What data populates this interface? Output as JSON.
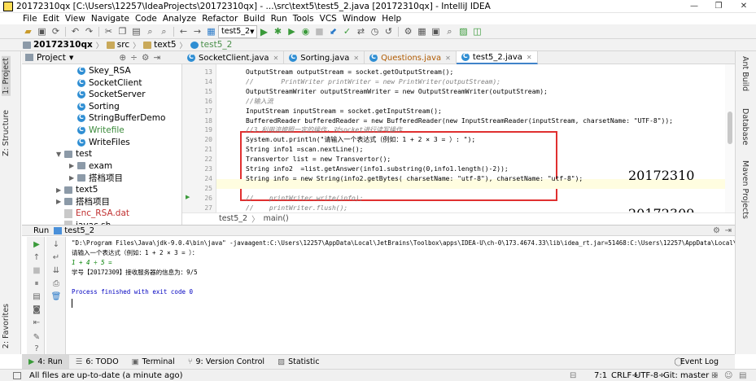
{
  "window": {
    "title": "20172310qx [C:\\Users\\12257\\IdeaProjects\\20172310qx] - ...\\src\\text5\\test5_2.java [20172310qx] - IntelliJ IDEA",
    "minimize": "—",
    "maximize": "❐",
    "close": "✕"
  },
  "menu": [
    "File",
    "Edit",
    "View",
    "Navigate",
    "Code",
    "Analyze",
    "Refactor",
    "Build",
    "Run",
    "Tools",
    "VCS",
    "Window",
    "Help"
  ],
  "toolbar": {
    "run_config": "test5_2"
  },
  "breadcrumb": [
    "20172310qx",
    "src",
    "text5",
    "test5_2"
  ],
  "project_panel": {
    "header": "Project",
    "items": [
      {
        "label": "Skey_RSA",
        "type": "class",
        "indent": 2,
        "arrow": ""
      },
      {
        "label": "SocketClient",
        "type": "class",
        "indent": 2,
        "arrow": ""
      },
      {
        "label": "SocketServer",
        "type": "class",
        "indent": 2,
        "arrow": ""
      },
      {
        "label": "Sorting",
        "type": "class",
        "indent": 2,
        "arrow": ""
      },
      {
        "label": "StringBufferDemo",
        "type": "class",
        "indent": 2,
        "arrow": ""
      },
      {
        "label": "Writefile",
        "type": "class-green",
        "indent": 2,
        "arrow": ""
      },
      {
        "label": "WriteFiles",
        "type": "class",
        "indent": 2,
        "arrow": ""
      },
      {
        "label": "test",
        "type": "folder",
        "indent": 1,
        "arrow": "▼"
      },
      {
        "label": "exam",
        "type": "folder",
        "indent": 2,
        "arrow": "▶"
      },
      {
        "label": "搭档项目",
        "type": "folder",
        "indent": 2,
        "arrow": "▶"
      },
      {
        "label": "text5",
        "type": "folder",
        "indent": 1,
        "arrow": "▶"
      },
      {
        "label": "搭档项目",
        "type": "folder",
        "indent": 1,
        "arrow": "▶"
      },
      {
        "label": "Enc_RSA.dat",
        "type": "file-red",
        "indent": 0,
        "arrow": ""
      },
      {
        "label": "javac.sh",
        "type": "file",
        "indent": 0,
        "arrow": ""
      }
    ]
  },
  "editor_tabs": [
    {
      "label": "SocketClient.java",
      "active": false,
      "color": "#000000"
    },
    {
      "label": "Sorting.java",
      "active": false,
      "color": "#000000"
    },
    {
      "label": "Questions.java",
      "active": false,
      "color": "#b05a00"
    },
    {
      "label": "test5_2.java",
      "active": true,
      "color": "#000000"
    }
  ],
  "editor": {
    "line_numbers": [
      "13",
      "14",
      "15",
      "16",
      "17",
      "18",
      "19",
      "20",
      "21",
      "22",
      "23",
      "24",
      "25",
      "26",
      "27",
      "28"
    ],
    "lines": [
      {
        "text": "OutputStream outputStream = socket.getOutputStream();",
        "style": "plain"
      },
      {
        "text": "//       PrintWriter printWriter = new PrintWriter(outputStream);",
        "style": "comment"
      },
      {
        "text": "OutputStreamWriter outputStreamWriter = new OutputStreamWriter(outputStream);",
        "style": "plain"
      },
      {
        "text": "//输入流",
        "style": "comment"
      },
      {
        "text": "InputStream inputStream = socket.getInputStream();",
        "style": "plain"
      },
      {
        "text": "BufferedReader bufferedReader = new BufferedReader(new InputStreamReader(inputStream, charsetName: \"UTF-8\"));",
        "style": "plain"
      },
      {
        "text": "//3.利用流按照一定的操作，对socket进行读写操作",
        "style": "comment"
      },
      {
        "text": "System.out.println(\"请输入一个表达式（例如：1 + 2 × 3 = ）: \");",
        "style": "plain"
      },
      {
        "text": "String info1 =scan.nextLine();",
        "style": "plain"
      },
      {
        "text": "Transvertor list = new Transvertor();",
        "style": "plain"
      },
      {
        "text": "String info2  =list.getAnswer(info1.substring(0,info1.length()-2));",
        "style": "plain"
      },
      {
        "text": "String info = new String(info2.getBytes( charsetName: \"utf-8\"), charsetName: \"utf-8\");",
        "style": "plain"
      },
      {
        "text": "",
        "style": "plain"
      },
      {
        "text": "//    printWriter.write(info);",
        "style": "comment"
      },
      {
        "text": "//    printWriter.flush();",
        "style": "comment"
      },
      {
        "text": "",
        "style": "plain"
      }
    ],
    "breadcrumb": [
      "test5_2",
      "main()"
    ]
  },
  "annotations": {
    "top": "20172310",
    "bottom": "20172309"
  },
  "run_panel": {
    "label": "Run",
    "config": "test5_2",
    "console": [
      {
        "text": "\"D:\\Program Files\\Java\\jdk-9.0.4\\bin\\java\" -javaagent:C:\\Users\\12257\\AppData\\Local\\JetBrains\\Toolbox\\apps\\IDEA-U\\ch-0\\173.4674.33\\lib\\idea_rt.jar=51468:C:\\Users\\12257\\AppData\\Local\\JetBrains\\Too",
        "color": "#000000"
      },
      {
        "text": "请输入一个表达式（例如：1 + 2 × 3 = ）：",
        "color": "#000000"
      },
      {
        "text": "1 + 4 ÷ 5 =",
        "color": "#008000"
      },
      {
        "text": "学号【20172309】接收服务器的信息为：9/5",
        "color": "#000000"
      },
      {
        "text": "",
        "color": "#000000"
      },
      {
        "text": "Process finished with exit code 0",
        "color": "#0000c0"
      }
    ]
  },
  "bottom_tabs": [
    {
      "label": "4: Run",
      "active": true
    },
    {
      "label": "6: TODO",
      "active": false
    },
    {
      "label": "Terminal",
      "active": false
    },
    {
      "label": "9: Version Control",
      "active": false
    },
    {
      "label": "Statistic",
      "active": false
    }
  ],
  "event_log": "Event Log",
  "status": {
    "message": "All files are up-to-date (a minute ago)",
    "position": "7:1",
    "line_sep": "CRLF÷",
    "encoding": "UTF-8÷",
    "git": "Git: master ÷"
  },
  "side_tabs": {
    "left": [
      "1: Project",
      "Z: Structure",
      "2: Favorites"
    ],
    "right": [
      "Ant Build",
      "Database",
      "Maven Projects"
    ]
  }
}
